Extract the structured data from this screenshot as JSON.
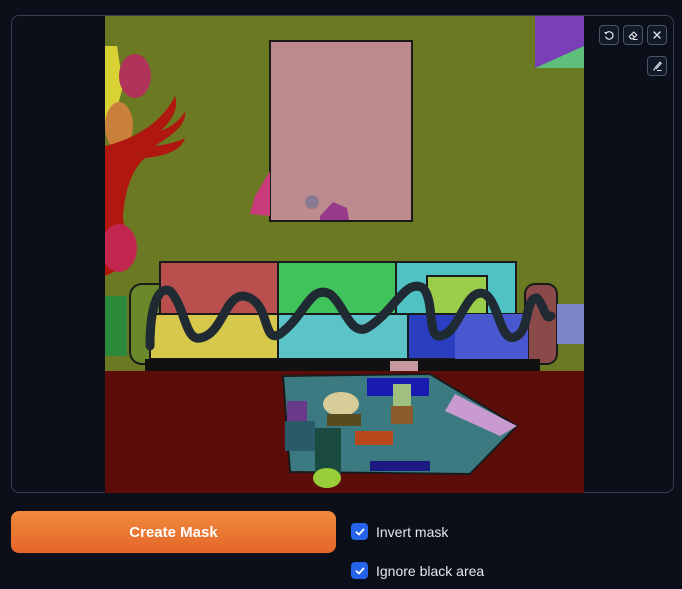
{
  "canvas": {
    "toolbar": {
      "undo_icon": "undo-icon",
      "erase_icon": "eraser-icon",
      "close_icon": "close-icon",
      "brush_icon": "brush-icon"
    },
    "image_description_icons": "segmentation-mask-image"
  },
  "actions": {
    "create_mask_label": "Create Mask"
  },
  "options": [
    {
      "label": "Invert mask",
      "checked": true
    },
    {
      "label": "Ignore black area",
      "checked": true
    }
  ],
  "colors": {
    "background": "#0b0f19",
    "accent_orange": "#e86f2e",
    "checkbox_blue": "#2563eb"
  }
}
